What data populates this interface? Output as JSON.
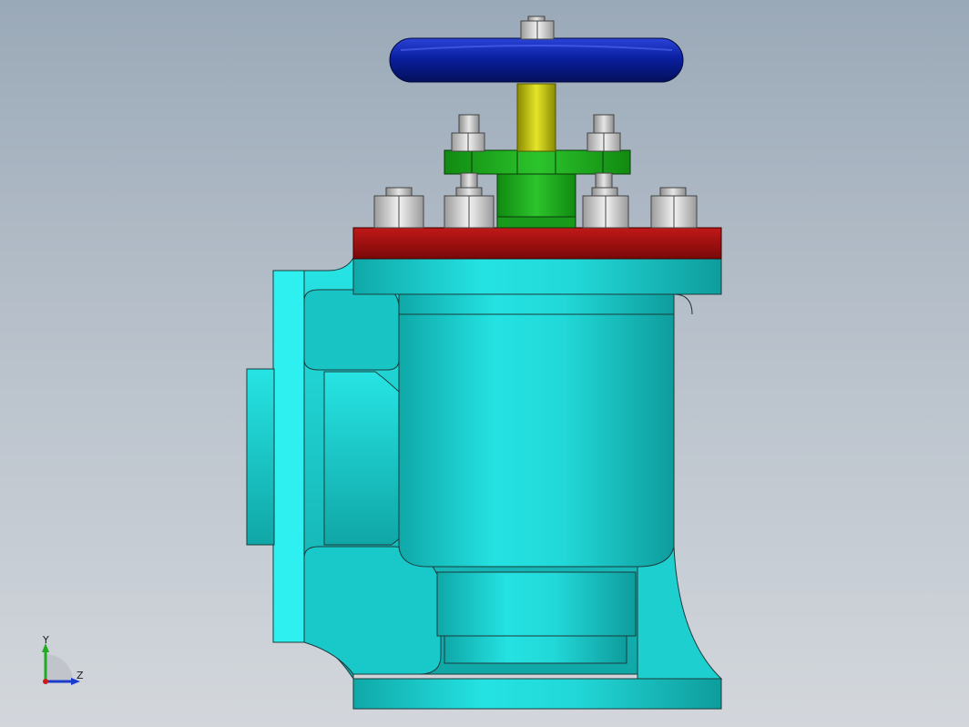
{
  "viewport": {
    "background_top": "#9aa9b8",
    "background_bottom": "#d3d7dc"
  },
  "model": {
    "handwheel_color": "#0a1fa0",
    "stem_color": "#c8c800",
    "gland_color": "#1fa01f",
    "bonnet_flange_color": "#a01010",
    "body_color": "#1ad6d6",
    "bolt_color": "#d8d8d8"
  },
  "triad": {
    "y_label": "Y",
    "z_label": "Z",
    "icon": "coordinate-triad-icon"
  }
}
